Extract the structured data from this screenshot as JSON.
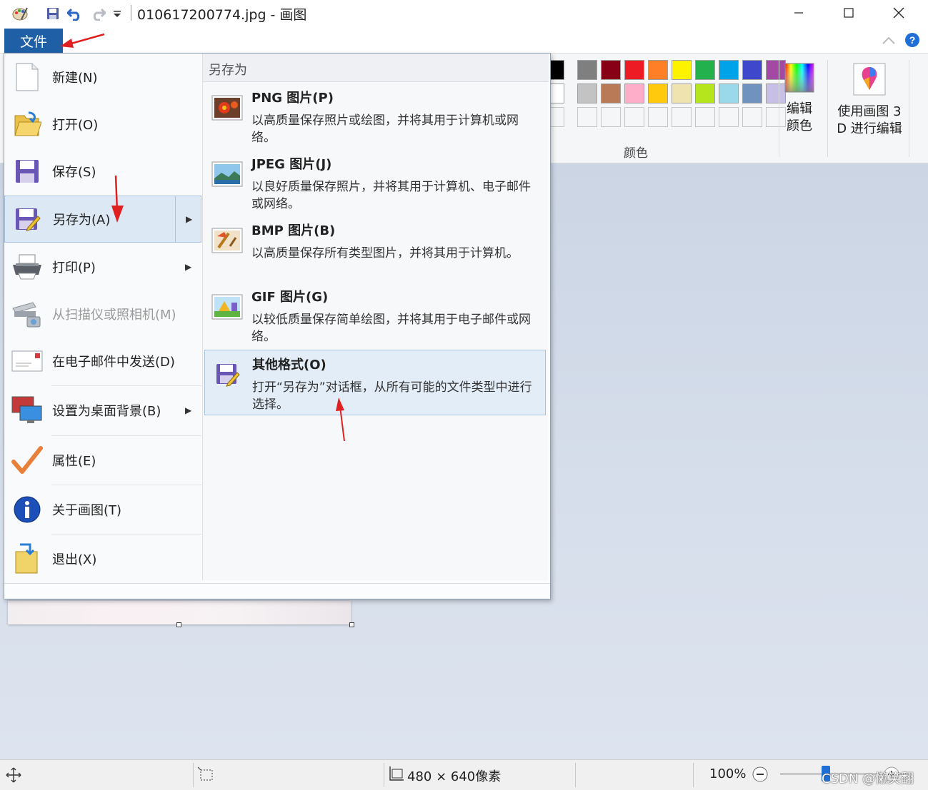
{
  "window": {
    "title": "010617200774.jpg - 画图"
  },
  "ribbon": {
    "file_tab": "文件",
    "colors_group": "颜色",
    "edit_colors": "编辑\n颜色",
    "paint3d": "使用画图 3\nD 进行编辑",
    "palette_row1": [
      "#000000",
      "#7f7f7f",
      "#880015",
      "#ed1c24",
      "#ff7f27",
      "#fff200",
      "#22b14c",
      "#00a2e8",
      "#3f48cc",
      "#a349a4"
    ],
    "palette_row2": [
      "#ffffff",
      "#c3c3c3",
      "#b97a57",
      "#ffaec9",
      "#ffc90e",
      "#efe4b0",
      "#b5e61d",
      "#99d9ea",
      "#7092be",
      "#c8bfe7"
    ]
  },
  "file_menu": {
    "items": [
      {
        "label": "新建(N)"
      },
      {
        "label": "打开(O)"
      },
      {
        "label": "保存(S)"
      },
      {
        "label": "另存为(A)"
      },
      {
        "label": "打印(P)"
      },
      {
        "label": "从扫描仪或照相机(M)"
      },
      {
        "label": "在电子邮件中发送(D)"
      },
      {
        "label": "设置为桌面背景(B)"
      },
      {
        "label": "属性(E)"
      },
      {
        "label": "关于画图(T)"
      },
      {
        "label": "退出(X)"
      }
    ],
    "submenu": {
      "header": "另存为",
      "items": [
        {
          "title": "PNG 图片(P)",
          "desc": "以高质量保存照片或绘图，并将其用于计算机或网络。"
        },
        {
          "title": "JPEG 图片(J)",
          "desc": "以良好质量保存照片，并将其用于计算机、电子邮件或网络。"
        },
        {
          "title": "BMP 图片(B)",
          "desc": "以高质量保存所有类型图片，并将其用于计算机。"
        },
        {
          "title": "GIF 图片(G)",
          "desc": "以较低质量保存简单绘图，并将其用于电子邮件或网络。"
        },
        {
          "title": "其他格式(O)",
          "desc": "打开“另存为”对话框，从所有可能的文件类型中进行选择。"
        }
      ]
    }
  },
  "statusbar": {
    "dimensions": "480 × 640像素",
    "zoom": "100%",
    "watermark": "CSDN @懒笑翻"
  }
}
